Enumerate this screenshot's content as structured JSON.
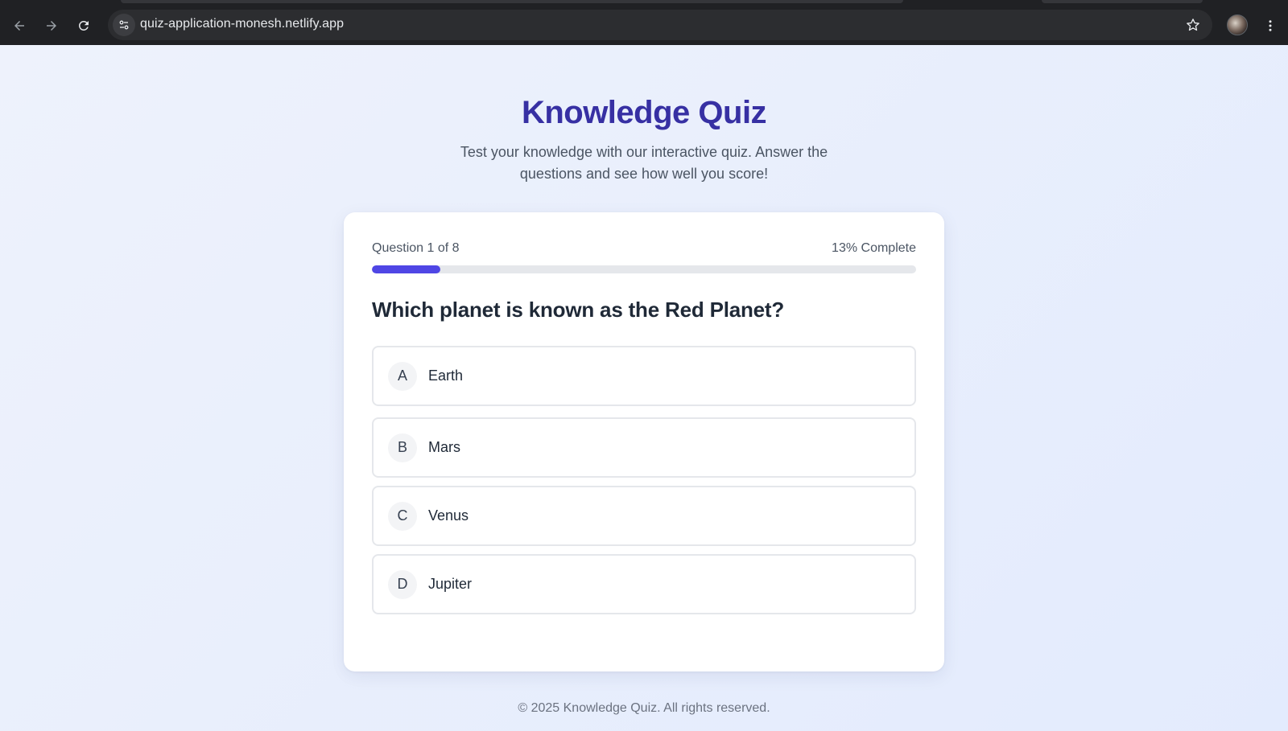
{
  "browser": {
    "url": "quiz-application-monesh.netlify.app",
    "icons": {
      "back": "arrow-left-icon",
      "forward": "arrow-right-icon",
      "reload": "reload-icon",
      "site_info": "tune-icon",
      "bookmark": "star-icon",
      "menu": "kebab-menu-icon"
    }
  },
  "header": {
    "title": "Knowledge Quiz",
    "subtitle": "Test your knowledge with our interactive quiz. Answer the questions and see how well you score!"
  },
  "quiz": {
    "progress_label": "Question 1 of 8",
    "progress_percent_label": "13% Complete",
    "progress_fraction": 0.125,
    "question": "Which planet is known as the Red Planet?",
    "options": [
      {
        "letter": "A",
        "text": "Earth"
      },
      {
        "letter": "B",
        "text": "Mars"
      },
      {
        "letter": "C",
        "text": "Venus"
      },
      {
        "letter": "D",
        "text": "Jupiter"
      }
    ]
  },
  "footer": {
    "text": "© 2025 Knowledge Quiz. All rights reserved."
  },
  "colors": {
    "title": "#3730a3",
    "accent": "#4f46e5",
    "track": "#e5e7eb",
    "chrome": "#202124"
  }
}
